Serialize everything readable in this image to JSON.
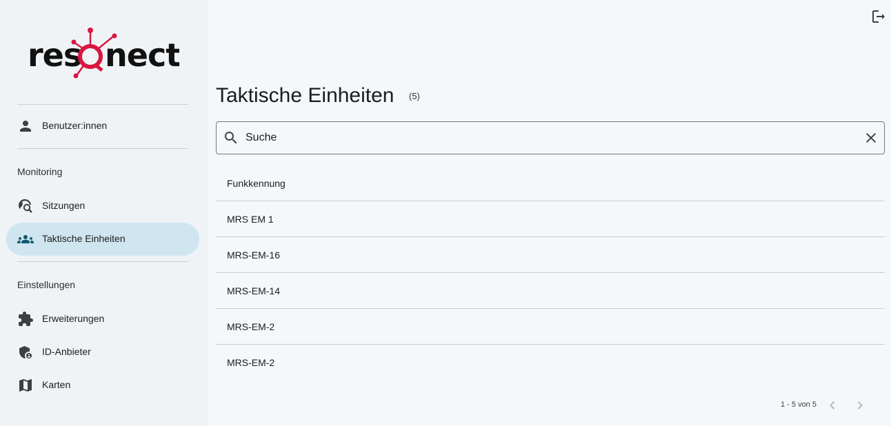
{
  "brand": {
    "logo_text": "resQnect",
    "accent_color": "#d9163f"
  },
  "sidebar": {
    "items": [
      {
        "label": "Benutzer:innen",
        "icon": "person-icon"
      },
      {
        "label": "Sitzungen",
        "icon": "session-search-icon"
      },
      {
        "label": "Taktische Einheiten",
        "icon": "groups-icon",
        "active": true
      },
      {
        "label": "Erweiterungen",
        "icon": "extension-puzzle-icon"
      },
      {
        "label": "ID-Anbieter",
        "icon": "admin-shield-icon"
      },
      {
        "label": "Karten",
        "icon": "map-icon"
      }
    ],
    "sections": {
      "monitoring": "Monitoring",
      "einstellungen": "Einstellungen"
    },
    "active_color": "#cfe5ef"
  },
  "header": {
    "logout_icon": "logout-icon"
  },
  "main": {
    "title": "Taktische Einheiten",
    "count": "(5)",
    "search": {
      "placeholder": "Suche",
      "value": ""
    },
    "table": {
      "header": "Funkkennung",
      "rows": [
        "MRS EM 1",
        "MRS-EM-16",
        "MRS-EM-14",
        "MRS-EM-2",
        "MRS-EM-2"
      ]
    },
    "pagination": {
      "range_text": "1 - 5 von 5"
    }
  }
}
